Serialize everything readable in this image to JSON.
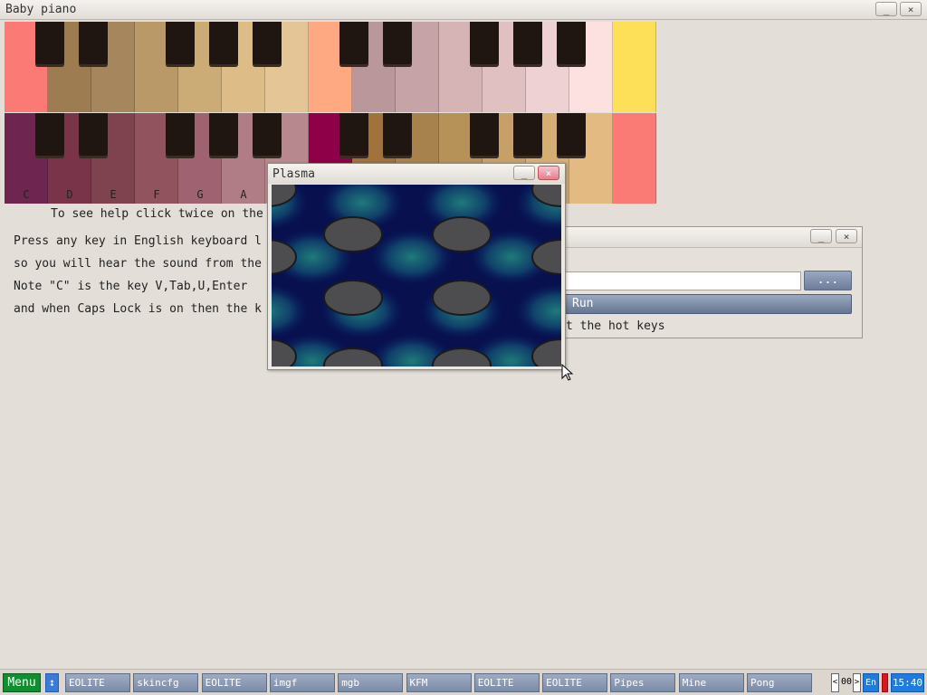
{
  "main_window": {
    "title": "Baby piano",
    "min": "_",
    "max": "□",
    "close": "×"
  },
  "piano": {
    "top_row": [
      "#fb7a76",
      "#9e7c52",
      "#a6865c",
      "#b99967",
      "#cbab76",
      "#ddbc87",
      "#e4c596",
      "#fea981",
      "#b9979a",
      "#c6a3a6",
      "#d6b4b6",
      "#e1c0c2",
      "#eed1d2",
      "#fde0e0",
      "#fde058"
    ],
    "bottom_row": [
      "#6e2550",
      "#7a3449",
      "#7f4350",
      "#91545e",
      "#9f6270",
      "#b07d86",
      "#b8888f",
      "#8e0047",
      "#a0723c",
      "#a8824c",
      "#b69158",
      "#c6a068",
      "#d5ae74",
      "#e2ba82",
      "#fa7a76"
    ],
    "labels": [
      "C",
      "D",
      "E",
      "F",
      "G",
      "A"
    ]
  },
  "help": {
    "line1": "To see help click twice on the",
    "line2": "Press any key in English keyboard l",
    "line3": "so you will hear the sound from the",
    "line4": "Note \"C\" is the key V,Tab,U,Enter",
    "line5": "and when Caps Lock is on then the k"
  },
  "run_dialog": {
    "min": "_",
    "close": "×",
    "browse": "...",
    "run": "Run",
    "hint": "t the hot keys"
  },
  "plasma_window": {
    "title": "Plasma",
    "min": "_",
    "close": "×"
  },
  "taskbar": {
    "menu": "Menu",
    "updown": "↕",
    "tasks": [
      "EOLITE",
      "skincfg",
      "EOLITE",
      "imgf",
      "mgb",
      "KFM",
      "EOLITE",
      "EOLITE",
      "Pipes",
      "Mine",
      "Pong"
    ],
    "counter": "00",
    "lang": "En",
    "clock": "15:40"
  },
  "colors": {
    "accent": "#7c8ba6",
    "menu": "#0f8f2f",
    "clock": "#1e7ce0"
  }
}
